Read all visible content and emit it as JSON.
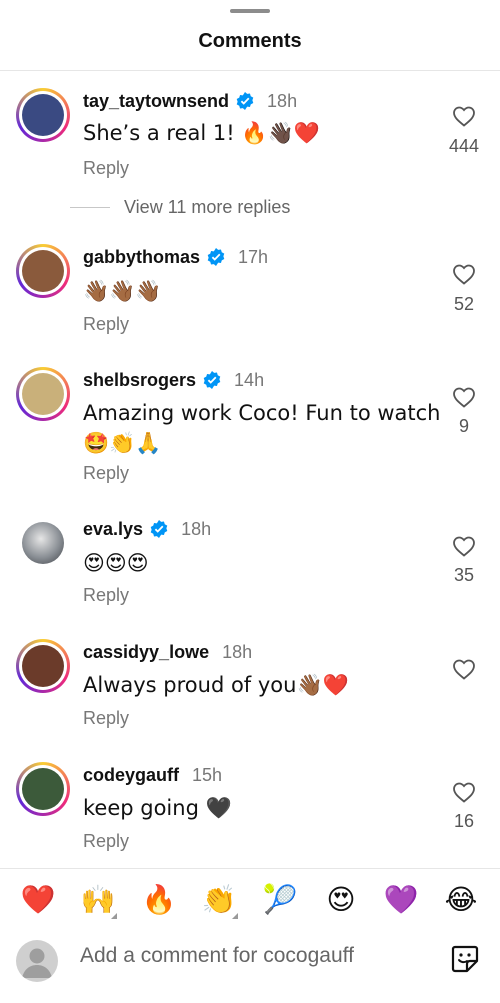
{
  "sheet": {
    "title": "Comments",
    "view_more": "View 11 more replies"
  },
  "comments": [
    {
      "username": "tay_taytownsend",
      "verified": true,
      "time": "18h",
      "text": "She’s a real 1! 🔥👋🏿❤️",
      "reply": "Reply",
      "likes": "444",
      "ring": "gradient",
      "avatar_color": "#3a4a82"
    },
    {
      "username": "gabbythomas",
      "verified": true,
      "time": "17h",
      "text": "👋🏾👋🏾👋🏾",
      "reply": "Reply",
      "likes": "52",
      "ring": "gradient",
      "avatar_color": "#8a5a3c"
    },
    {
      "username": "shelbsrogers",
      "verified": true,
      "time": "14h",
      "text": "Amazing work Coco! Fun to watch 🤩👏🙏",
      "reply": "Reply",
      "likes": "9",
      "ring": "gradient",
      "avatar_color": "#c9b07a"
    },
    {
      "username": "eva.lys",
      "verified": true,
      "time": "18h",
      "text": "😍😍😍",
      "reply": "Reply",
      "likes": "35",
      "ring": "plain",
      "avatar_color": "#9aa0a6"
    },
    {
      "username": "cassidyy_lowe",
      "verified": false,
      "time": "18h",
      "text": "Always proud of you👋🏾❤️",
      "reply": "Reply",
      "likes": "",
      "ring": "gradient",
      "avatar_color": "#6b3b2a"
    },
    {
      "username": "codeygauff",
      "verified": false,
      "time": "15h",
      "text": "keep going 🖤",
      "reply": "Reply",
      "likes": "16",
      "ring": "gradient",
      "avatar_color": "#3c5a3a"
    }
  ],
  "reactions": [
    "❤️",
    "🙌",
    "🔥",
    "👏",
    "🎾",
    "😍",
    "💜",
    "😂"
  ],
  "composer": {
    "placeholder": "Add a comment for cocogauff"
  },
  "icons": {
    "heart": "heart-outline-icon",
    "verified": "verified-badge-icon",
    "sticker": "sticker-icon",
    "avatar": "user-avatar-icon"
  },
  "colors": {
    "verified": "#0095f6",
    "muted": "#777777",
    "ring_start": "#f9ce34",
    "ring_mid": "#ee2a7b",
    "ring_end": "#6228d7"
  }
}
